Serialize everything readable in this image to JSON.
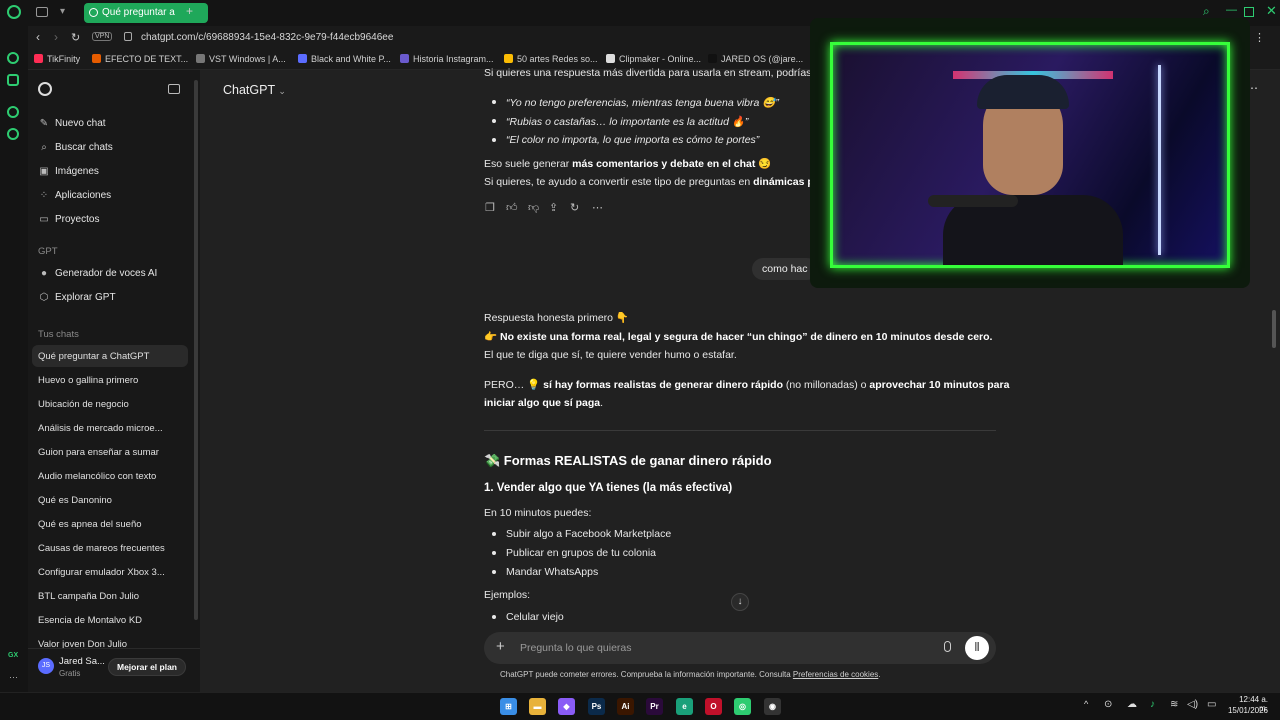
{
  "browser": {
    "tab_title": "Qué preguntar a ChatGPT",
    "url": "chatgpt.com/c/69688934-15e4-832c-9e79-f44ecb9646ee",
    "vpn_label": "VPN",
    "gx_label": "GX"
  },
  "bookmarks": [
    {
      "label": "TikFinity",
      "color": "#ff2d55"
    },
    {
      "label": "EFECTO DE TEXT...",
      "color": "#e65c00"
    },
    {
      "label": "VST Windows | A...",
      "color": "#777777"
    },
    {
      "label": "Black and White P...",
      "color": "#5b6cff"
    },
    {
      "label": "Historia Instagram...",
      "color": "#6a5acd"
    },
    {
      "label": "50 artes Redes so...",
      "color": "#fbbc04"
    },
    {
      "label": "Clipmaker - Online...",
      "color": "#dddddd"
    },
    {
      "label": "JARED OS (@jare...",
      "color": "#111111"
    }
  ],
  "sidebar": {
    "nav": [
      {
        "label": "Nuevo chat",
        "icon": "✎"
      },
      {
        "label": "Buscar chats",
        "icon": "⌕"
      },
      {
        "label": "Imágenes",
        "icon": "▣"
      },
      {
        "label": "Aplicaciones",
        "icon": "⁘"
      },
      {
        "label": "Proyectos",
        "icon": "▭"
      }
    ],
    "gpt_section": "GPT",
    "gpts": [
      {
        "label": "Generador de voces AI",
        "icon": "●"
      },
      {
        "label": "Explorar GPT",
        "icon": "⬡"
      }
    ],
    "chats_section": "Tus chats",
    "chats": [
      "Qué preguntar a ChatGPT",
      "Huevo o gallina primero",
      "Ubicación de negocio",
      "Análisis de mercado microe...",
      "Guion para enseñar a sumar",
      "Audio melancólico con texto",
      "Qué es Danonino",
      "Qué es apnea del sueño",
      "Causas de mareos frecuentes",
      "Configurar emulador Xbox 3...",
      "BTL campaña Don Julio",
      "Esencia de Montalvo KD",
      "Valor joven Don Julio"
    ],
    "user": {
      "initials": "JS",
      "name": "Jared Sa...",
      "plan": "Gratis",
      "upgrade": "Mejorar el plan"
    }
  },
  "header": {
    "model": "ChatGPT",
    "more": "⋯"
  },
  "conversation": {
    "top_line": "Si quieres una respuesta más divertida para usarla en stream, podrías de",
    "quotes": [
      "“Yo no tengo preferencias, mientras tenga buena vibra 😅”",
      "“Rubias o castañas… lo importante es la actitud 🔥”",
      "“El color no importa, lo que importa es cómo te portes”"
    ],
    "line1_pre": "Eso suele generar ",
    "line1_bold": "más comentarios y debate en el chat",
    "line1_post": " 😏",
    "line2_pre": "Si quieres, te ayudo a convertir este tipo de preguntas en ",
    "line2_bold": "dinámicas para",
    "user_msg": "como hac",
    "honest": "Respuesta honesta primero 👇",
    "no_exists_pre": "👉 ",
    "no_exists_bold": "No existe una forma real, legal y segura de hacer “un chingo” de dinero en 10 minutos desde cero.",
    "sells_smoke": "El que te diga que sí, te quiere vender humo o estafar.",
    "pero_pre": "PERO… 💡 ",
    "pero_bold1": "sí hay formas realistas de generar dinero rápido",
    "pero_mid": " (no millonadas) o ",
    "pero_bold2": "aprovechar 10 minutos para",
    "pero_line2": "iniciar algo que sí paga",
    "pero_dot": ".",
    "section_title": "💸 Formas REALISTAS de ganar dinero rápido",
    "subsection": "1. Vender algo que YA tienes (la más efectiva)",
    "ten_min": "En 10 minutos puedes:",
    "steps": [
      "Subir algo a Facebook Marketplace",
      "Publicar en grupos de tu colonia",
      "Mandar WhatsApps"
    ],
    "examples": "Ejemplos:",
    "example_items": [
      "Celular viejo"
    ]
  },
  "composer": {
    "placeholder": "Pregunta lo que quieras",
    "disclaimer_pre": "ChatGPT puede cometer errores. Comprueba la información importante. Consulta ",
    "disclaimer_link": "Preferencias de cookies",
    "disclaimer_post": "."
  },
  "taskbar": {
    "time": "12:44 a. m.",
    "date": "15/01/2026",
    "apps": [
      {
        "name": "windows-start",
        "color": "#3a8ee6",
        "glyph": "⊞"
      },
      {
        "name": "file-explorer",
        "color": "#e8b23a",
        "glyph": "▬"
      },
      {
        "name": "copilot",
        "color": "#8a5cf6",
        "glyph": "◆"
      },
      {
        "name": "photoshop",
        "color": "#0b2a4a",
        "glyph": "Ps"
      },
      {
        "name": "illustrator",
        "color": "#3a1600",
        "glyph": "Ai"
      },
      {
        "name": "premiere",
        "color": "#2a0a3a",
        "glyph": "Pr"
      },
      {
        "name": "edge",
        "color": "#1aa07a",
        "glyph": "e"
      },
      {
        "name": "opera-gx",
        "color": "#c0102a",
        "glyph": "O"
      },
      {
        "name": "whatsapp-like",
        "color": "#2ecc71",
        "glyph": "◎"
      },
      {
        "name": "obs",
        "color": "#333333",
        "glyph": "◉"
      }
    ]
  }
}
